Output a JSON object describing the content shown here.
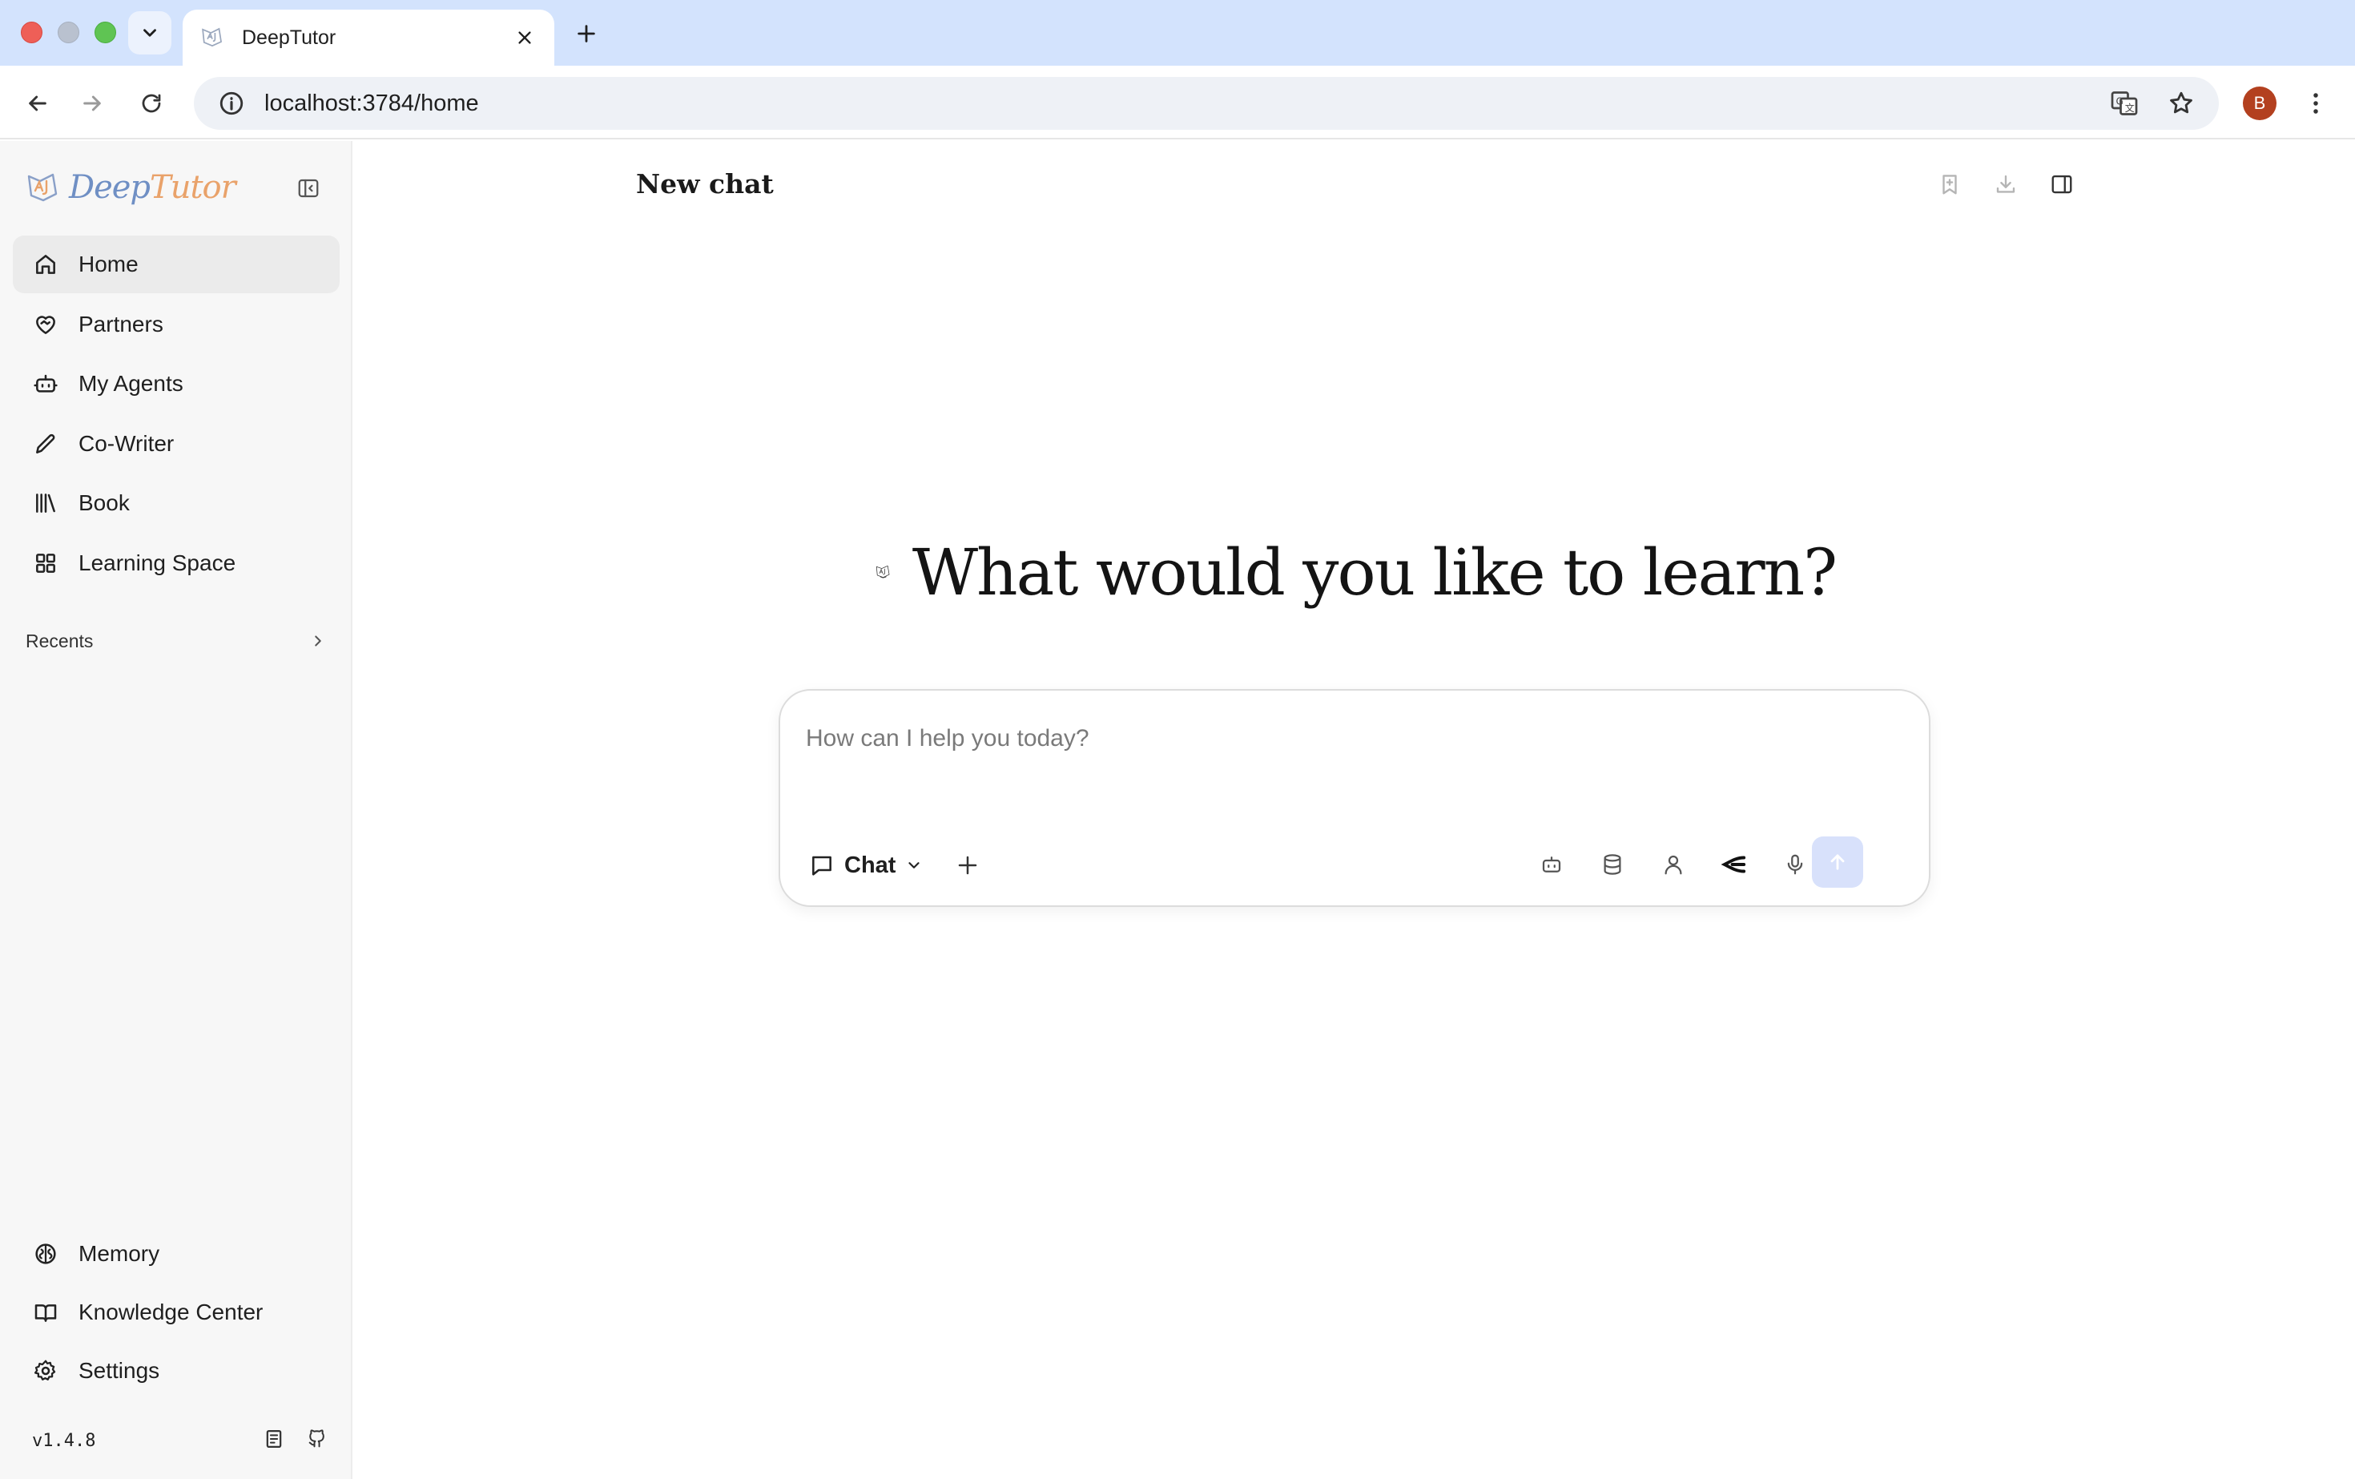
{
  "browser": {
    "tab_title": "DeepTutor",
    "url": "localhost:3784/home",
    "profile_initial": "B"
  },
  "sidebar": {
    "brand_part1": "Deep",
    "brand_part2": "Tutor",
    "nav": [
      {
        "label": "Home",
        "icon": "home-icon",
        "active": true
      },
      {
        "label": "Partners",
        "icon": "heart-handshake-icon"
      },
      {
        "label": "My Agents",
        "icon": "bot-icon"
      },
      {
        "label": "Co-Writer",
        "icon": "pen-icon"
      },
      {
        "label": "Book",
        "icon": "library-icon"
      },
      {
        "label": "Learning Space",
        "icon": "grid-icon"
      }
    ],
    "recents_label": "Recents",
    "bottom": [
      {
        "label": "Memory",
        "icon": "brain-icon"
      },
      {
        "label": "Knowledge Center",
        "icon": "book-open-icon"
      },
      {
        "label": "Settings",
        "icon": "gear-icon"
      }
    ],
    "version": "v1.4.8"
  },
  "main": {
    "title": "New chat",
    "hero": "What would you like to learn?",
    "composer": {
      "placeholder": "How can I help you today?",
      "mode": "Chat"
    }
  },
  "colors": {
    "tabbar": "#d3e3fd",
    "sidebar_bg": "#f7f7f7",
    "send_button": "#d8e1fb",
    "avatar": "#b3401f",
    "brand_blue": "#6f8fc4",
    "brand_orange": "#e9a26a"
  }
}
